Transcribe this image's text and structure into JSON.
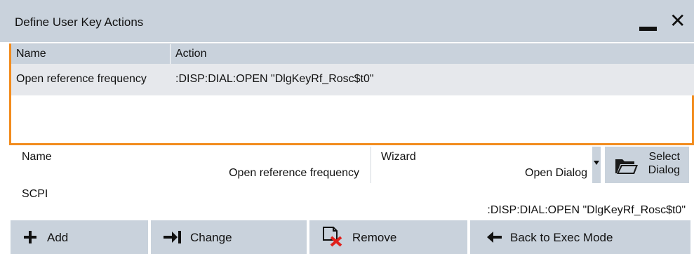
{
  "dialog": {
    "title": "Define User Key Actions"
  },
  "table": {
    "headers": [
      "Name",
      "Action"
    ],
    "rows": [
      {
        "name": "Open reference frequency",
        "action": ":DISP:DIAL:OPEN \"DlgKeyRf_Rosc$t0\""
      }
    ]
  },
  "form": {
    "name_label": "Name",
    "name_value": "Open reference frequency",
    "wizard_label": "Wizard",
    "wizard_value": "Open Dialog",
    "select_dialog_line1": "Select",
    "select_dialog_line2": "Dialog",
    "scpi_label": "SCPI",
    "scpi_value": ":DISP:DIAL:OPEN \"DlgKeyRf_Rosc$t0\""
  },
  "buttons": {
    "add": "Add",
    "change": "Change",
    "remove": "Remove",
    "back": "Back to Exec Mode"
  },
  "colors": {
    "accent": "#f28c1e",
    "panel": "#c9d2dc",
    "remove_icon": "#e0201b"
  },
  "icons": {
    "minimize": "minimize-icon",
    "close": "close-icon",
    "folder": "folder-icon",
    "add": "plus-icon",
    "change": "arrow-right-bar-icon",
    "remove": "document-remove-icon",
    "back": "arrow-left-icon"
  }
}
